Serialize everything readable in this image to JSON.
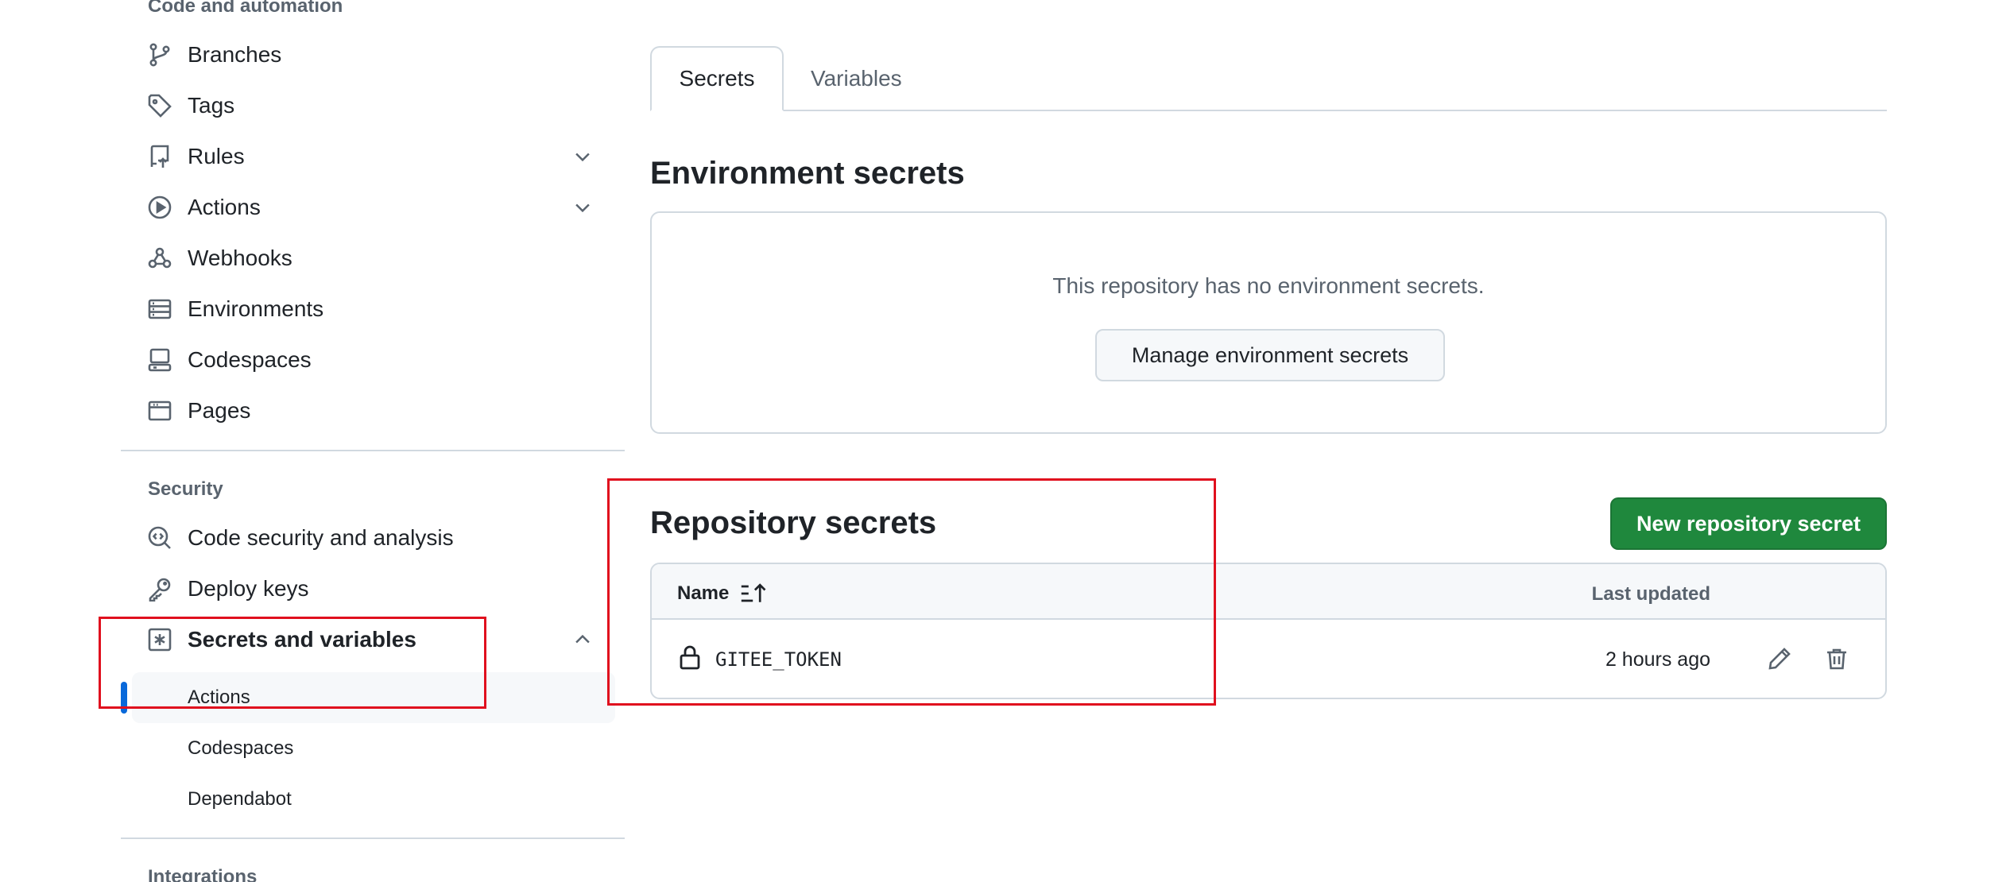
{
  "sidebar": {
    "headings": {
      "code_automation": "Code and automation",
      "security": "Security",
      "integrations": "Integrations"
    },
    "items": [
      {
        "label": "Branches",
        "icon": "git-branch-icon"
      },
      {
        "label": "Tags",
        "icon": "tag-icon"
      },
      {
        "label": "Rules",
        "icon": "repo-push-icon",
        "expandable": true
      },
      {
        "label": "Actions",
        "icon": "play-icon",
        "expandable": true
      },
      {
        "label": "Webhooks",
        "icon": "webhook-icon"
      },
      {
        "label": "Environments",
        "icon": "server-icon"
      },
      {
        "label": "Codespaces",
        "icon": "codespaces-icon"
      },
      {
        "label": "Pages",
        "icon": "browser-icon"
      }
    ],
    "security_items": [
      {
        "label": "Code security and analysis",
        "icon": "codescan-icon"
      },
      {
        "label": "Deploy keys",
        "icon": "key-icon"
      },
      {
        "label": "Secrets and variables",
        "icon": "asterisk-icon",
        "expanded": true
      }
    ],
    "sub_items": [
      {
        "label": "Actions",
        "selected": true
      },
      {
        "label": "Codespaces"
      },
      {
        "label": "Dependabot"
      }
    ]
  },
  "tabs": [
    {
      "label": "Secrets",
      "active": true
    },
    {
      "label": "Variables"
    }
  ],
  "environment_secrets": {
    "title": "Environment secrets",
    "empty_text": "This repository has no environment secrets.",
    "manage_button": "Manage environment secrets"
  },
  "repository_secrets": {
    "title": "Repository secrets",
    "new_button": "New repository secret",
    "columns": {
      "name": "Name",
      "last_updated": "Last updated"
    },
    "rows": [
      {
        "name": "GITEE_TOKEN",
        "updated": "2 hours ago"
      }
    ]
  },
  "colors": {
    "accent": "#0969da",
    "primary_button": "#1f883d",
    "highlight": "#e0101e"
  }
}
